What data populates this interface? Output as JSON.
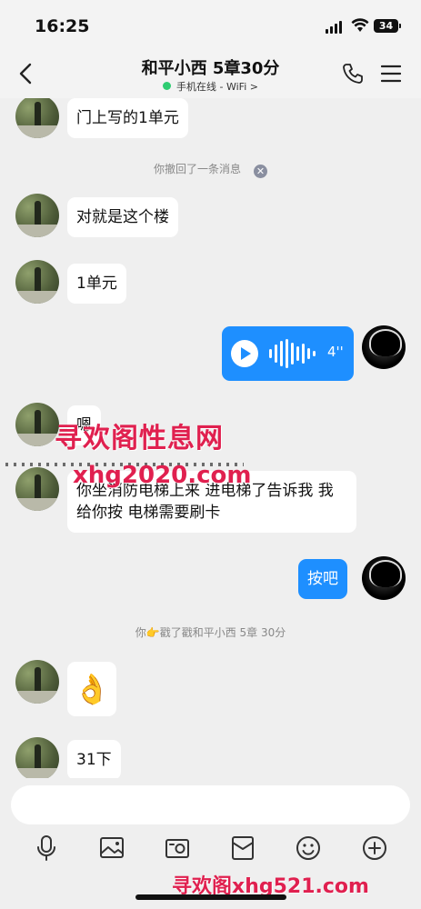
{
  "status_bar": {
    "time": "16:25",
    "battery": "34"
  },
  "header": {
    "title": "和平小西 5章30分",
    "subtitle": "手机在线 - WiFi >"
  },
  "messages": [
    {
      "side": "left",
      "text": "门上写的1单元"
    },
    {
      "side": "system",
      "text": "你撤回了一条消息"
    },
    {
      "side": "left",
      "text": "对就是这个楼"
    },
    {
      "side": "left",
      "text": "1单元"
    },
    {
      "side": "right",
      "type": "voice",
      "duration": "4''"
    },
    {
      "side": "left",
      "text": "嗯"
    },
    {
      "side": "left",
      "text": "你坐消防电梯上来  进电梯了告诉我  我给你按  电梯需要刷卡"
    },
    {
      "side": "right",
      "text": "按吧"
    },
    {
      "side": "system",
      "text": "你👉戳了戳和平小西 5章 30分"
    },
    {
      "side": "left",
      "type": "emoji",
      "text": "👌"
    },
    {
      "side": "left",
      "text": "31下"
    }
  ],
  "watermarks": {
    "top": "寻欢阁性息网",
    "middle": "xhg2020.com",
    "bottom": "寻欢阁xhg521.com"
  },
  "input": {
    "placeholder": ""
  },
  "toolbar": [
    "mic-icon",
    "image-icon",
    "camera-icon",
    "red-packet-icon",
    "emoji-icon",
    "plus-icon"
  ],
  "colors": {
    "accent": "#1e8fff",
    "online": "#2ecc71",
    "watermark": "#e0204f"
  }
}
